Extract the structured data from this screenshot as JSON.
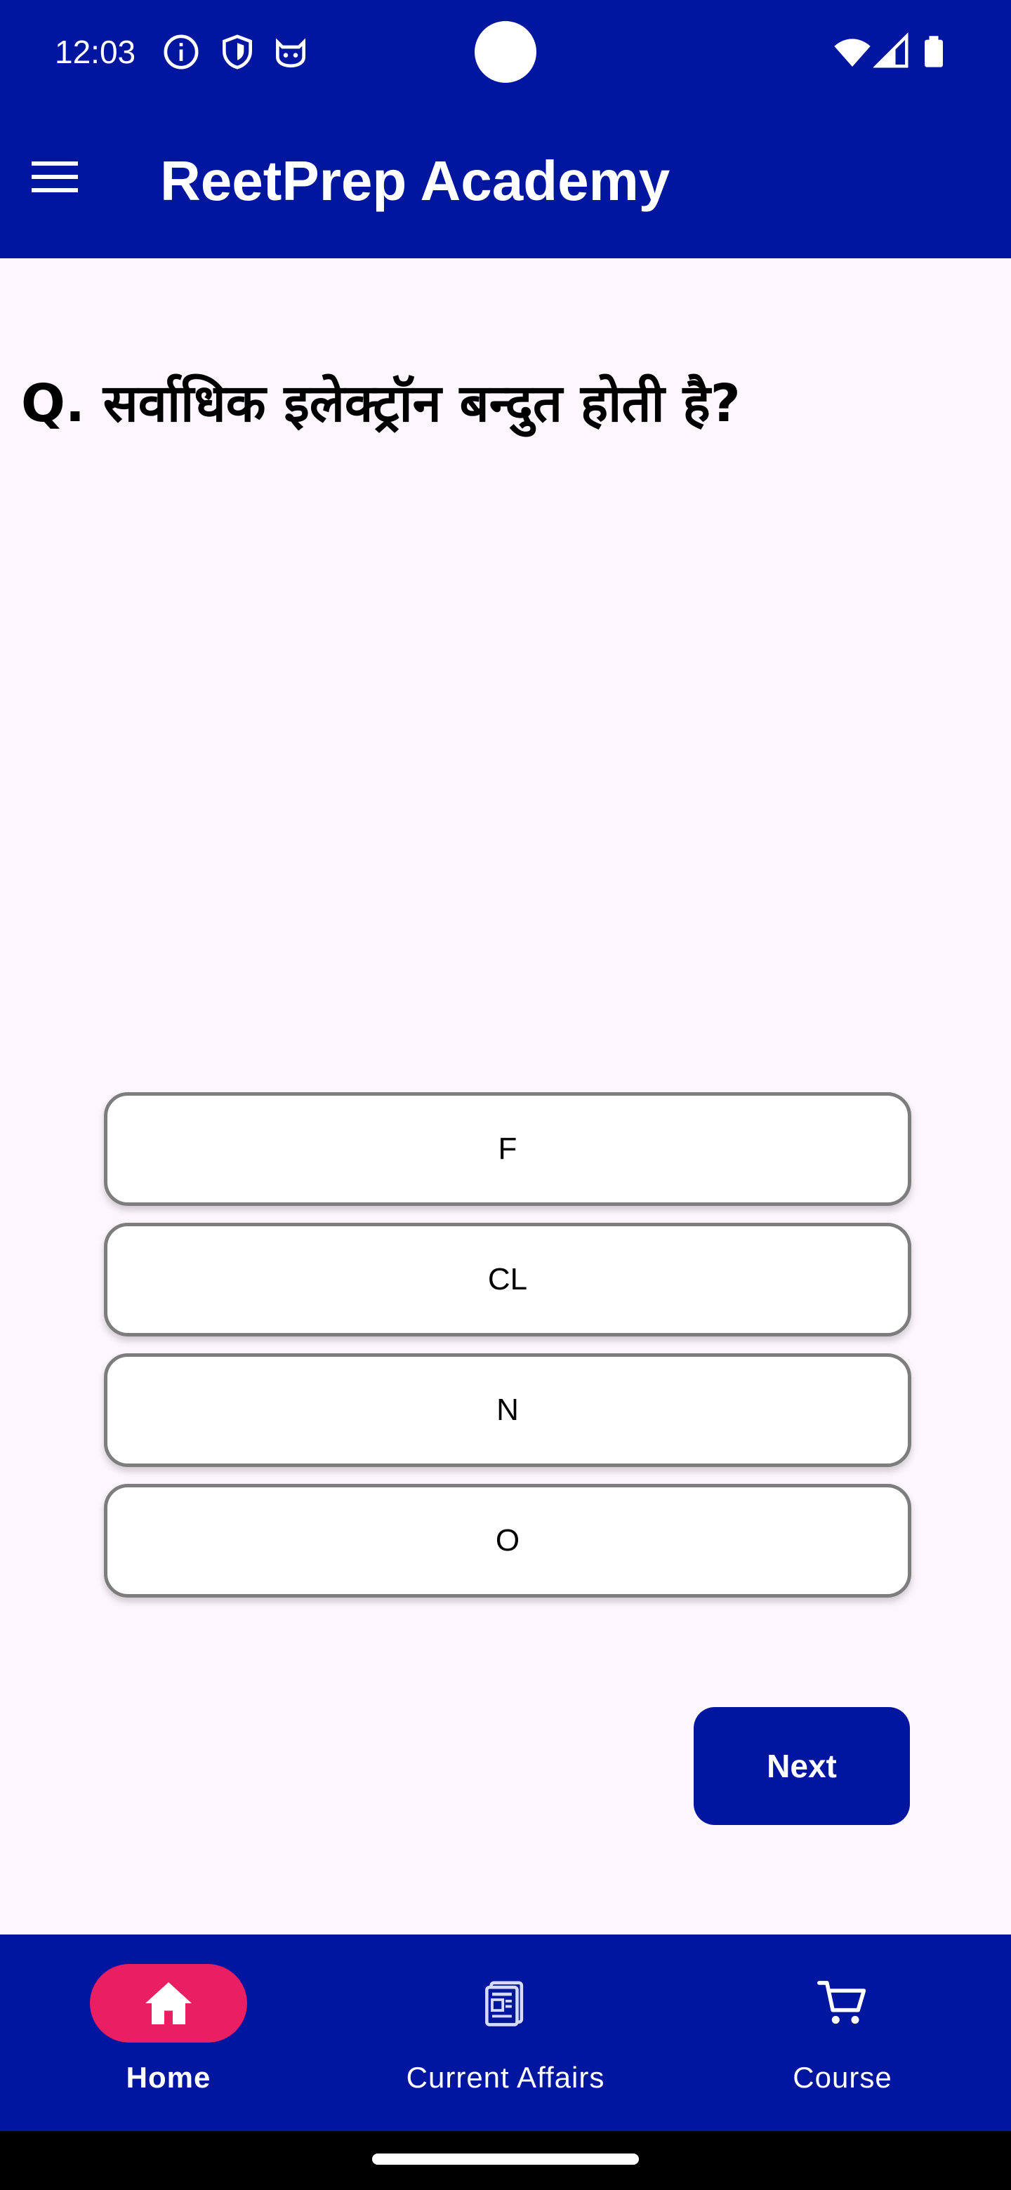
{
  "status_bar": {
    "time": "12:03",
    "left_icons": [
      "info-icon",
      "shield-icon",
      "cat-icon"
    ],
    "right_icons": [
      "wifi-icon",
      "signal-icon",
      "battery-icon"
    ]
  },
  "app_bar": {
    "title": "ReetPrep Academy",
    "menu_icon": "hamburger-menu-icon"
  },
  "quiz": {
    "question": "Q. सर्वाधिक इलेक्ट्रॉन बन्दुत होती है?",
    "options": [
      "F",
      "CL",
      "N",
      "O"
    ],
    "next_label": "Next"
  },
  "bottom_nav": {
    "items": [
      {
        "label": "Home",
        "icon": "home-icon",
        "active": true
      },
      {
        "label": "Current Affairs",
        "icon": "newspaper-icon",
        "active": false
      },
      {
        "label": "Course",
        "icon": "cart-icon",
        "active": false
      }
    ]
  },
  "colors": {
    "primary": "#00169e",
    "accent": "#e91e63",
    "background": "#fdf7fd",
    "option_border": "#7d7d7d"
  }
}
